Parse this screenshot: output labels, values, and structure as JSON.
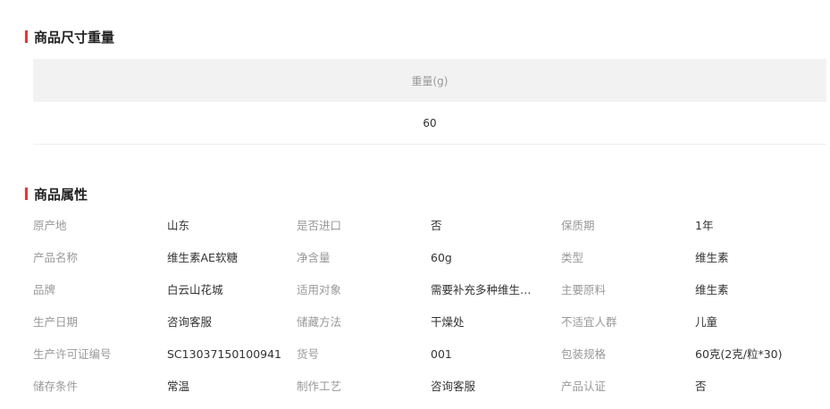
{
  "size_section": {
    "title": "商品尺寸重量",
    "column_header": "重量(g)",
    "value": "60"
  },
  "attributes_section": {
    "title": "商品属性",
    "rows": [
      {
        "k1": "原产地",
        "v1": "山东",
        "k2": "是否进口",
        "v2": "否",
        "k3": "保质期",
        "v3": "1年"
      },
      {
        "k1": "产品名称",
        "v1": "维生素AE软糖",
        "k2": "净含量",
        "v2": "60g",
        "k3": "类型",
        "v3": "维生素"
      },
      {
        "k1": "品牌",
        "v1": "白云山花城",
        "k2": "适用对象",
        "v2": "需要补充多种维生素...",
        "k3": "主要原料",
        "v3": "维生素"
      },
      {
        "k1": "生产日期",
        "v1": "咨询客服",
        "k2": "储藏方法",
        "v2": "干燥处",
        "k3": "不适宜人群",
        "v3": "儿童"
      },
      {
        "k1": "生产许可证编号",
        "v1": "SC13037150100941",
        "k2": "货号",
        "v2": "001",
        "k3": "包装规格",
        "v3": "60克(2克/粒*30)"
      },
      {
        "k1": "储存条件",
        "v1": "常温",
        "k2": "制作工艺",
        "v2": "咨询客服",
        "k3": "产品认证",
        "v3": "否"
      }
    ]
  },
  "colors": {
    "accent_bar": "#e4393c",
    "header_bg": "#f2f2f2",
    "label_text": "#999999",
    "value_text": "#333333"
  }
}
